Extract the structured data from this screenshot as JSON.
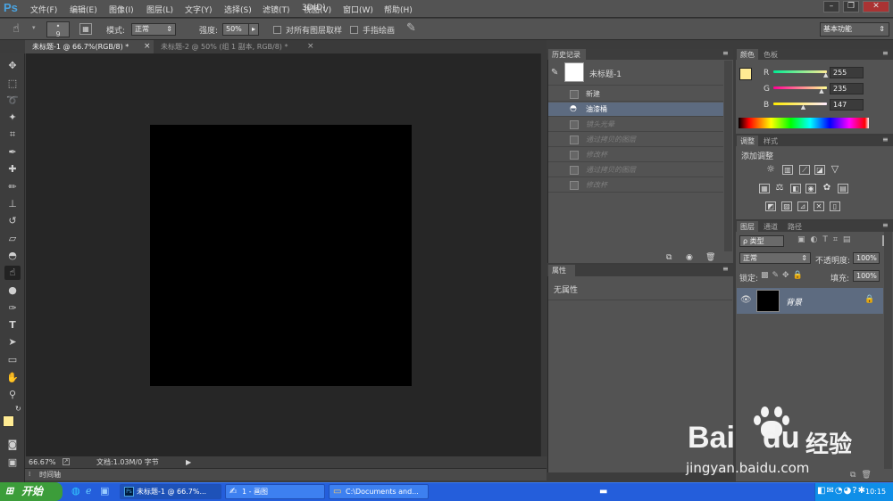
{
  "app": {
    "logo": "Ps"
  },
  "menu": [
    "文件(F)",
    "编辑(E)",
    "图像(I)",
    "图层(L)",
    "文字(Y)",
    "选择(S)",
    "滤镜(T)",
    "3D(D)",
    "视图(V)",
    "窗口(W)",
    "帮助(H)"
  ],
  "window_buttons": [
    "–",
    "❐",
    "✕"
  ],
  "options": {
    "brush_size": "9",
    "mode_label": "模式:",
    "mode_value": "正常",
    "strength_label": "强度:",
    "strength_value": "50%",
    "sample_all_label": "对所有图层取样",
    "finger_paint_label": "手指绘画",
    "workspace": "基本功能"
  },
  "tabs": [
    {
      "label": "未标题-1 @ 66.7%(RGB/8) *",
      "close": "×"
    },
    {
      "label": "未标题-2 @ 50% (组 1 副本, RGB/8) *",
      "close": "×"
    }
  ],
  "status": {
    "zoom": "66.67%",
    "doc": "文档:1.03M/0 字节",
    "timeline": "时间轴"
  },
  "history": {
    "title": "历史记录",
    "snapshot": "未标题-1",
    "items": [
      {
        "label": "新建",
        "state": "normal"
      },
      {
        "label": "油漆桶",
        "state": "active"
      },
      {
        "label": "镜头光晕",
        "state": "dim"
      },
      {
        "label": "通过拷贝的图层",
        "state": "dim"
      },
      {
        "label": "修改杯",
        "state": "dim"
      },
      {
        "label": "通过拷贝的图层",
        "state": "dim"
      },
      {
        "label": "修改杯",
        "state": "dim"
      }
    ]
  },
  "properties": {
    "title": "属性",
    "content": "无属性"
  },
  "color_panel": {
    "tabs": [
      "颜色",
      "色板"
    ],
    "fg_color": "#FFEB93",
    "r_label": "R",
    "r_value": "255",
    "r_level": 1.0,
    "g_label": "G",
    "g_value": "235",
    "g_level": 0.92,
    "b_label": "B",
    "b_value": "147",
    "b_level": 0.58
  },
  "adjustments": {
    "tabs": [
      "调整",
      "样式"
    ],
    "heading": "添加调整"
  },
  "layers": {
    "tabs": [
      "图层",
      "通道",
      "路径"
    ],
    "filter": "ρ 类型",
    "blend": "正常",
    "opacity_label": "不透明度:",
    "opacity_value": "100%",
    "lock_label": "锁定:",
    "fill_label": "填充:",
    "fill_value": "100%",
    "layer_name": "背景"
  },
  "taskbar": {
    "start": "开始",
    "items": [
      "未标题-1 @ 66.7%...",
      "1 - 画图",
      "C:\\Documents and..."
    ],
    "time": "10:15"
  },
  "watermark": {
    "brand": "Bai",
    "brand2": "du",
    "brand_cn": "经验",
    "url": "jingyan.baidu.com"
  }
}
